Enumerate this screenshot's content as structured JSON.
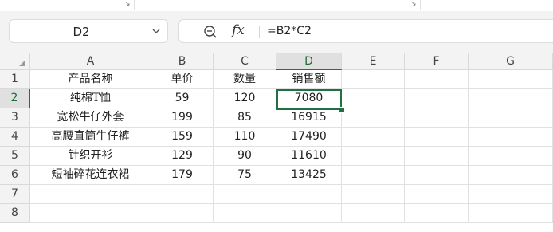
{
  "formula_bar": {
    "name_box": "D2",
    "fx_label": "fx",
    "formula": "=B2*C2"
  },
  "sheet": {
    "columns": [
      "A",
      "B",
      "C",
      "D",
      "E",
      "F",
      "G"
    ],
    "rows": [
      "1",
      "2",
      "3",
      "4",
      "5",
      "6",
      "7",
      "8"
    ],
    "active_column": "D",
    "active_row": "2",
    "selection_color": "#1e7145",
    "cells": [
      [
        "产品名称",
        "单价",
        "数量",
        "销售额",
        "",
        "",
        ""
      ],
      [
        "纯棉T恤",
        "59",
        "120",
        "7080",
        "",
        "",
        ""
      ],
      [
        "宽松牛仔外套",
        "199",
        "85",
        "16915",
        "",
        "",
        ""
      ],
      [
        "高腰直筒牛仔裤",
        "159",
        "110",
        "17490",
        "",
        "",
        ""
      ],
      [
        "针织开衫",
        "129",
        "90",
        "11610",
        "",
        "",
        ""
      ],
      [
        "短袖碎花连衣裙",
        "179",
        "75",
        "13425",
        "",
        "",
        ""
      ],
      [
        "",
        "",
        "",
        "",
        "",
        "",
        ""
      ],
      [
        "",
        "",
        "",
        "",
        "",
        "",
        ""
      ]
    ]
  }
}
